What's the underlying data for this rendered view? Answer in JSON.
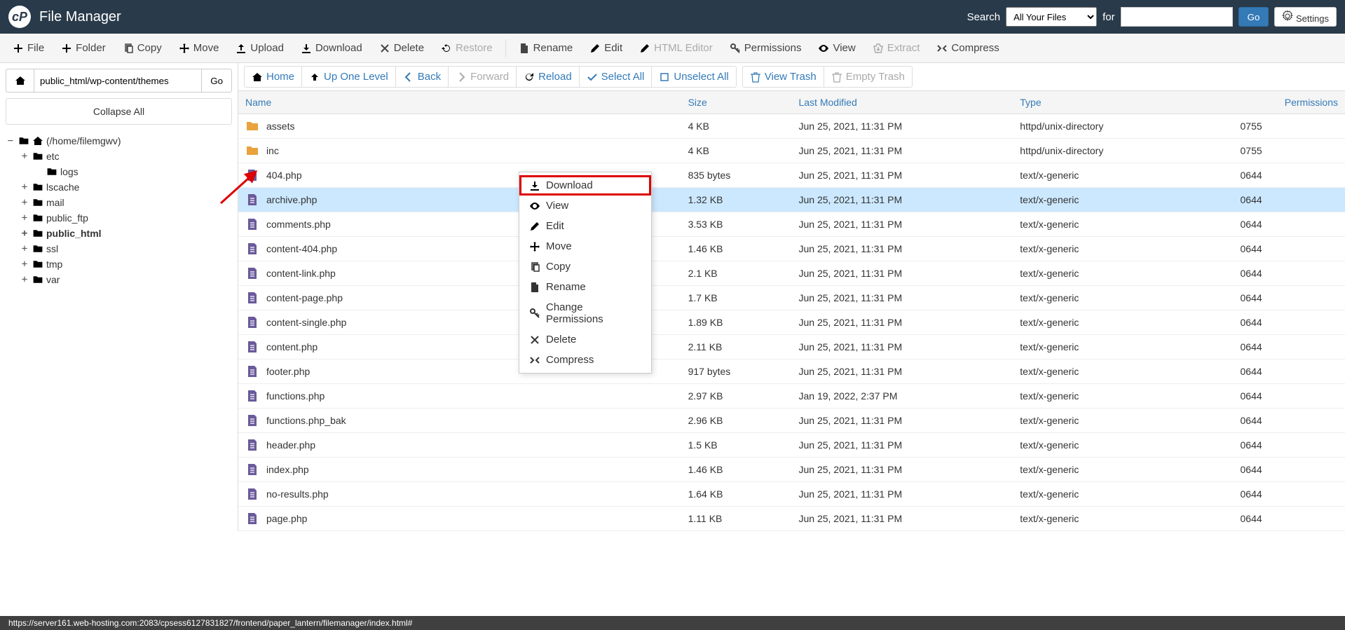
{
  "header": {
    "title": "File Manager",
    "search_label": "Search",
    "search_select": "All Your Files",
    "for_label": "for",
    "search_value": "",
    "go": "Go",
    "settings": "Settings"
  },
  "toolbar": {
    "file": "File",
    "folder": "Folder",
    "copy": "Copy",
    "move": "Move",
    "upload": "Upload",
    "download": "Download",
    "delete": "Delete",
    "restore": "Restore",
    "rename": "Rename",
    "edit": "Edit",
    "html_editor": "HTML Editor",
    "permissions": "Permissions",
    "view": "View",
    "extract": "Extract",
    "compress": "Compress"
  },
  "path": "public_html/wp-content/themes",
  "path_go": "Go",
  "collapse_all": "Collapse All",
  "tree": {
    "root": "(/home/filemgwv)",
    "nodes": [
      {
        "label": "etc",
        "expandable": true
      },
      {
        "label": "logs",
        "expandable": false,
        "indent": 1
      },
      {
        "label": "lscache",
        "expandable": true
      },
      {
        "label": "mail",
        "expandable": true
      },
      {
        "label": "public_ftp",
        "expandable": true
      },
      {
        "label": "public_html",
        "expandable": true,
        "bold": true
      },
      {
        "label": "ssl",
        "expandable": true
      },
      {
        "label": "tmp",
        "expandable": true
      },
      {
        "label": "var",
        "expandable": true
      }
    ]
  },
  "nav": {
    "home": "Home",
    "up": "Up One Level",
    "back": "Back",
    "forward": "Forward",
    "reload": "Reload",
    "select_all": "Select All",
    "unselect_all": "Unselect All",
    "view_trash": "View Trash",
    "empty_trash": "Empty Trash"
  },
  "columns": {
    "name": "Name",
    "size": "Size",
    "modified": "Last Modified",
    "type": "Type",
    "perms": "Permissions"
  },
  "files": [
    {
      "name": "assets",
      "size": "4 KB",
      "modified": "Jun 25, 2021, 11:31 PM",
      "type": "httpd/unix-directory",
      "perms": "0755",
      "kind": "folder"
    },
    {
      "name": "inc",
      "size": "4 KB",
      "modified": "Jun 25, 2021, 11:31 PM",
      "type": "httpd/unix-directory",
      "perms": "0755",
      "kind": "folder"
    },
    {
      "name": "404.php",
      "size": "835 bytes",
      "modified": "Jun 25, 2021, 11:31 PM",
      "type": "text/x-generic",
      "perms": "0644",
      "kind": "file"
    },
    {
      "name": "archive.php",
      "size": "1.32 KB",
      "modified": "Jun 25, 2021, 11:31 PM",
      "type": "text/x-generic",
      "perms": "0644",
      "kind": "file",
      "selected": true
    },
    {
      "name": "comments.php",
      "size": "3.53 KB",
      "modified": "Jun 25, 2021, 11:31 PM",
      "type": "text/x-generic",
      "perms": "0644",
      "kind": "file"
    },
    {
      "name": "content-404.php",
      "size": "1.46 KB",
      "modified": "Jun 25, 2021, 11:31 PM",
      "type": "text/x-generic",
      "perms": "0644",
      "kind": "file"
    },
    {
      "name": "content-link.php",
      "size": "2.1 KB",
      "modified": "Jun 25, 2021, 11:31 PM",
      "type": "text/x-generic",
      "perms": "0644",
      "kind": "file"
    },
    {
      "name": "content-page.php",
      "size": "1.7 KB",
      "modified": "Jun 25, 2021, 11:31 PM",
      "type": "text/x-generic",
      "perms": "0644",
      "kind": "file"
    },
    {
      "name": "content-single.php",
      "size": "1.89 KB",
      "modified": "Jun 25, 2021, 11:31 PM",
      "type": "text/x-generic",
      "perms": "0644",
      "kind": "file"
    },
    {
      "name": "content.php",
      "size": "2.11 KB",
      "modified": "Jun 25, 2021, 11:31 PM",
      "type": "text/x-generic",
      "perms": "0644",
      "kind": "file"
    },
    {
      "name": "footer.php",
      "size": "917 bytes",
      "modified": "Jun 25, 2021, 11:31 PM",
      "type": "text/x-generic",
      "perms": "0644",
      "kind": "file"
    },
    {
      "name": "functions.php",
      "size": "2.97 KB",
      "modified": "Jan 19, 2022, 2:37 PM",
      "type": "text/x-generic",
      "perms": "0644",
      "kind": "file"
    },
    {
      "name": "functions.php_bak",
      "size": "2.96 KB",
      "modified": "Jun 25, 2021, 11:31 PM",
      "type": "text/x-generic",
      "perms": "0644",
      "kind": "file"
    },
    {
      "name": "header.php",
      "size": "1.5 KB",
      "modified": "Jun 25, 2021, 11:31 PM",
      "type": "text/x-generic",
      "perms": "0644",
      "kind": "file"
    },
    {
      "name": "index.php",
      "size": "1.46 KB",
      "modified": "Jun 25, 2021, 11:31 PM",
      "type": "text/x-generic",
      "perms": "0644",
      "kind": "file"
    },
    {
      "name": "no-results.php",
      "size": "1.64 KB",
      "modified": "Jun 25, 2021, 11:31 PM",
      "type": "text/x-generic",
      "perms": "0644",
      "kind": "file"
    },
    {
      "name": "page.php",
      "size": "1.11 KB",
      "modified": "Jun 25, 2021, 11:31 PM",
      "type": "text/x-generic",
      "perms": "0644",
      "kind": "file"
    }
  ],
  "context_menu": [
    {
      "label": "Download",
      "icon": "download",
      "highlight": true
    },
    {
      "label": "View",
      "icon": "eye"
    },
    {
      "label": "Edit",
      "icon": "pencil"
    },
    {
      "label": "Move",
      "icon": "move"
    },
    {
      "label": "Copy",
      "icon": "copy"
    },
    {
      "label": "Rename",
      "icon": "file"
    },
    {
      "label": "Change Permissions",
      "icon": "key"
    },
    {
      "label": "Delete",
      "icon": "close"
    },
    {
      "label": "Compress",
      "icon": "compress"
    }
  ],
  "status_url": "https://server161.web-hosting.com:2083/cpsess6127831827/frontend/paper_lantern/filemanager/index.html#"
}
